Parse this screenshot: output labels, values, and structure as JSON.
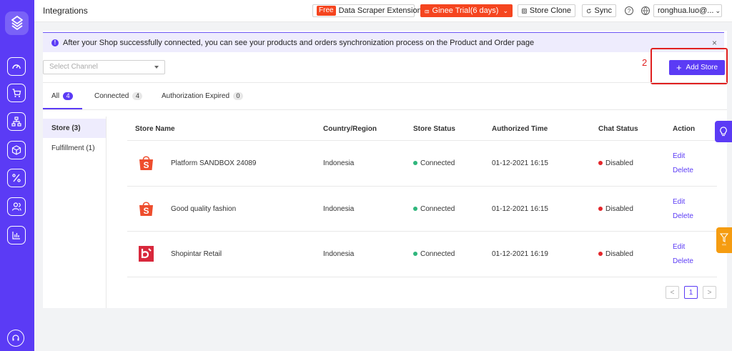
{
  "header": {
    "title": "Integrations",
    "free_tag": "Free",
    "scraper_label": "Data Scraper Extension",
    "trial_label": "Ginee Trial(6 days)",
    "clone_label": "Store Clone",
    "sync_label": "Sync",
    "user_label": "ronghua.luo@..."
  },
  "notice": {
    "text": "After your Shop successfully connected, you can see your products and orders synchronization process on the Product and Order page",
    "close": "×"
  },
  "filter": {
    "placeholder": "Select Channel"
  },
  "annotation": {
    "number": "2"
  },
  "add_store_label": "Add Store",
  "tabs": [
    {
      "label": "All",
      "count": "4"
    },
    {
      "label": "Connected",
      "count": "4"
    },
    {
      "label": "Authorization Expired",
      "count": "0"
    }
  ],
  "side": [
    {
      "label": "Store (3)"
    },
    {
      "label": "Fulfillment (1)"
    }
  ],
  "table": {
    "columns": [
      "Store Name",
      "Country/Region",
      "Store Status",
      "Authorized Time",
      "Chat Status",
      "Action"
    ],
    "rows": [
      {
        "platform": "shopee",
        "name": "Platform SANDBOX 24089",
        "country": "Indonesia",
        "status": "Connected",
        "time": "01-12-2021 16:15",
        "chat": "Disabled",
        "edit": "Edit",
        "delete": "Delete"
      },
      {
        "platform": "shopee",
        "name": "Good quality fashion",
        "country": "Indonesia",
        "status": "Connected",
        "time": "01-12-2021 16:15",
        "chat": "Disabled",
        "edit": "Edit",
        "delete": "Delete"
      },
      {
        "platform": "shopintar",
        "name": "Shopintar Retail",
        "country": "Indonesia",
        "status": "Connected",
        "time": "01-12-2021 16:19",
        "chat": "Disabled",
        "edit": "Edit",
        "delete": "Delete"
      }
    ]
  },
  "pagination": {
    "prev": "<",
    "page": "1",
    "next": ">"
  },
  "colors": {
    "brand": "#5b3bf5",
    "shopee": "#ee4d2d",
    "shopintar": "#d8283c",
    "connected": "#2fb67c",
    "disabled": "#e3262b",
    "trial": "#f5451f"
  },
  "icons": [
    "logo-icon",
    "dashboard-icon",
    "cart-icon",
    "hierarchy-icon",
    "package-icon",
    "percent-icon",
    "users-icon",
    "chart-icon",
    "headset-icon",
    "bulb-icon",
    "filter-icon",
    "question-icon",
    "globe-icon",
    "sync-icon",
    "clone-icon",
    "chevron-down-icon",
    "info-icon",
    "close-icon"
  ]
}
